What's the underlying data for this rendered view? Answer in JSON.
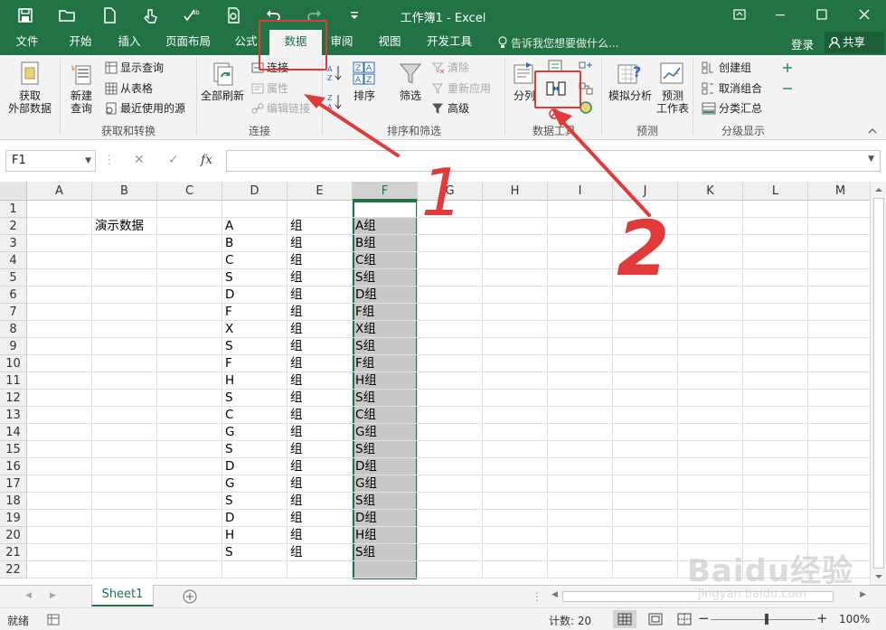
{
  "window": {
    "title": "工作簿1 - Excel"
  },
  "tabs": [
    {
      "label": "文件"
    },
    {
      "label": "开始"
    },
    {
      "label": "插入"
    },
    {
      "label": "页面布局"
    },
    {
      "label": "公式"
    },
    {
      "label": "数据"
    },
    {
      "label": "审阅"
    },
    {
      "label": "视图"
    },
    {
      "label": "开发工具"
    }
  ],
  "active_tab": "数据",
  "tell_me": "告诉我您想要做什么...",
  "login": "登录",
  "share": "共享",
  "ribbon": {
    "get_external": "获取\n外部数据",
    "new_query": "新建\n查询",
    "show_query": "显示查询",
    "from_table": "从表格",
    "recent_sources": "最近使用的源",
    "group_get_transform": "获取和转换",
    "refresh_all": "全部刷新",
    "connections": "连接",
    "properties": "属性",
    "edit_links": "编辑链接",
    "group_connections": "连接",
    "sort": "排序",
    "filter": "筛选",
    "clear": "清除",
    "reapply": "重新应用",
    "advanced": "高级",
    "group_sort_filter": "排序和筛选",
    "text_to_columns": "分列",
    "group_data_tools": "数据工具",
    "what_if": "模拟分析",
    "forecast_sheet": "预测\n工作表",
    "group_forecast": "预测",
    "group": "创建组",
    "ungroup": "取消组合",
    "subtotal": "分类汇总",
    "group_outline": "分级显示"
  },
  "formula_bar": {
    "name_box": "F1",
    "fx": "fx",
    "formula": ""
  },
  "columns": [
    "A",
    "B",
    "C",
    "D",
    "E",
    "F",
    "G",
    "H",
    "I",
    "J",
    "K",
    "L",
    "M"
  ],
  "selected_column": "F",
  "rows": [
    "1",
    "2",
    "3",
    "4",
    "5",
    "6",
    "7",
    "8",
    "9",
    "10",
    "11",
    "12",
    "13",
    "14",
    "15",
    "16",
    "17",
    "18",
    "19",
    "20",
    "21",
    "22"
  ],
  "cells": {
    "B2": "演示数据",
    "D": [
      "A",
      "B",
      "C",
      "S",
      "D",
      "F",
      "X",
      "S",
      "F",
      "H",
      "S",
      "C",
      "G",
      "S",
      "D",
      "G",
      "S",
      "D",
      "H",
      "S"
    ],
    "E": [
      "组",
      "组",
      "组",
      "组",
      "组",
      "组",
      "组",
      "组",
      "组",
      "组",
      "组",
      "组",
      "组",
      "组",
      "组",
      "组",
      "组",
      "组",
      "组",
      "组"
    ],
    "F": [
      "A组",
      "B组",
      "C组",
      "S组",
      "D组",
      "F组",
      "X组",
      "S组",
      "F组",
      "H组",
      "S组",
      "C组",
      "G组",
      "S组",
      "D组",
      "G组",
      "S组",
      "D组",
      "H组",
      "S组"
    ]
  },
  "sheet_tab": "Sheet1",
  "status": {
    "ready": "就绪",
    "count": "计数: 20",
    "zoom": "100%"
  },
  "annotations": {
    "arrow1_label": "1",
    "arrow2_label": "2",
    "color": "#e2393a"
  },
  "watermark": {
    "brand": "Baidu经验",
    "url": "jingyan.baidu.com"
  },
  "colors": {
    "accent": "#217346",
    "selection": "#c8c8c8"
  }
}
